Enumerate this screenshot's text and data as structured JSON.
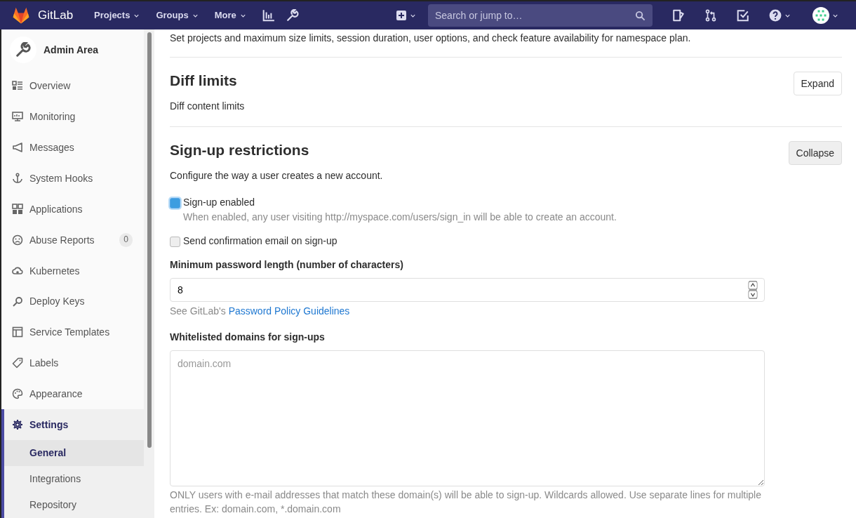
{
  "navbar": {
    "brand": "GitLab",
    "menus": [
      {
        "label": "Projects"
      },
      {
        "label": "Groups"
      },
      {
        "label": "More"
      }
    ],
    "search": {
      "placeholder": "Search or jump to…"
    }
  },
  "sidebar": {
    "title": "Admin Area",
    "items": [
      {
        "label": "Overview",
        "kind": "overview",
        "selected": false
      },
      {
        "label": "Monitoring",
        "kind": "monitor",
        "selected": false
      },
      {
        "label": "Messages",
        "kind": "megaphone",
        "selected": false
      },
      {
        "label": "System Hooks",
        "kind": "hook",
        "selected": false
      },
      {
        "label": "Applications",
        "kind": "apps",
        "selected": false
      },
      {
        "label": "Abuse Reports",
        "kind": "sad",
        "selected": false,
        "badge": "0"
      },
      {
        "label": "Kubernetes",
        "kind": "cloud",
        "selected": false
      },
      {
        "label": "Deploy Keys",
        "kind": "key",
        "selected": false
      },
      {
        "label": "Service Templates",
        "kind": "template",
        "selected": false
      },
      {
        "label": "Labels",
        "kind": "label",
        "selected": false
      },
      {
        "label": "Appearance",
        "kind": "palette",
        "selected": false
      },
      {
        "label": "Settings",
        "kind": "gear",
        "selected": true,
        "children": [
          {
            "label": "General",
            "selected": true
          },
          {
            "label": "Integrations",
            "selected": false
          },
          {
            "label": "Repository",
            "selected": false
          }
        ]
      }
    ]
  },
  "intro": "Set projects and maximum size limits, session duration, user options, and check feature availability for namespace plan.",
  "sections": [
    {
      "title": "Diff limits",
      "description": "Diff content limits",
      "button": "Expand",
      "expanded": false
    },
    {
      "title": "Sign-up restrictions",
      "description": "Configure the way a user creates a new account.",
      "button": "Collapse",
      "expanded": true
    }
  ],
  "form": {
    "checkboxes": [
      {
        "label": "Sign-up enabled",
        "checked": true,
        "help": "When enabled, any user visiting http://myspace.com/users/sign_in will be able to create an account."
      },
      {
        "label": "Send confirmation email on sign-up",
        "checked": false
      }
    ],
    "password_length": {
      "label": "Minimum password length (number of characters)",
      "value": "8",
      "help": "See GitLab's",
      "link": "Password Policy Guidelines"
    },
    "domains": {
      "label": "Whitelisted domains for sign-ups",
      "placeholder": "domain.com",
      "help": "ONLY users with e-mail addresses that match these domain(s) will be able to sign-up. Wildcards allowed. Use separate lines for multiple entries. Ex: domain.com, *.domain.com"
    }
  }
}
